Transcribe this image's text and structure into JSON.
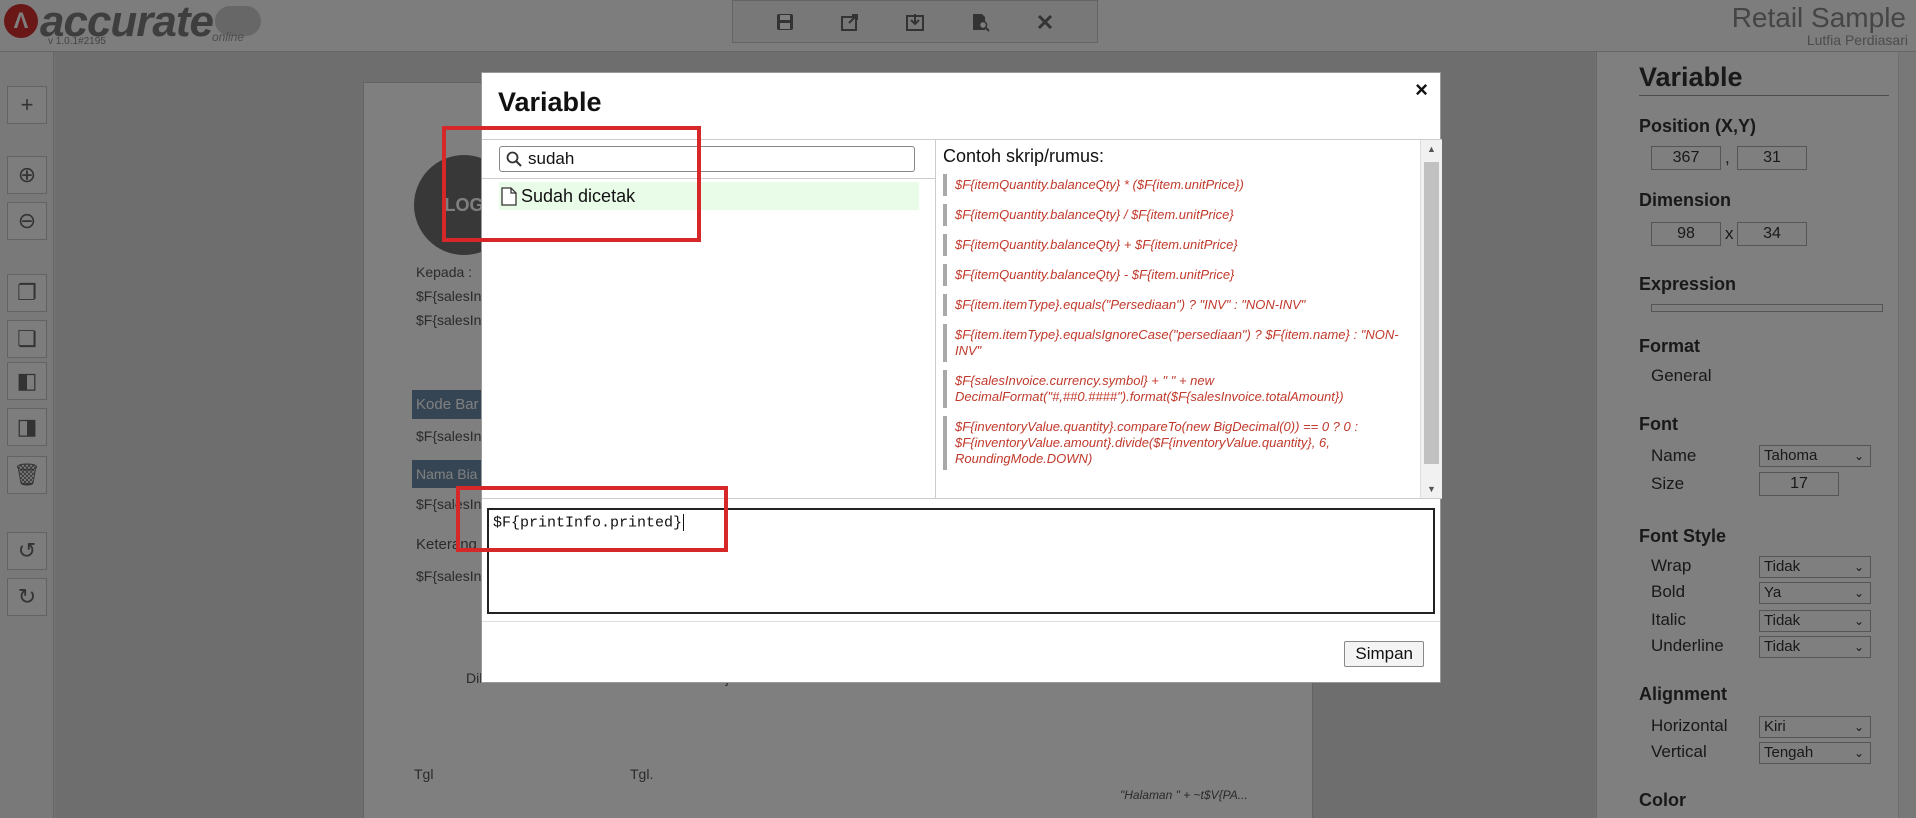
{
  "app": {
    "logo_mark": "Λ",
    "logo_text": "accurate",
    "logo_subtext": "online",
    "version": "v 1.0.1#2195",
    "title": "Retail Sample",
    "user": "Lutfia Perdiasari"
  },
  "toolbar": {
    "items": [
      "save-icon",
      "export-icon",
      "import-icon",
      "preview-icon",
      "close-icon"
    ]
  },
  "left_toolbar": {
    "items": [
      "add-icon",
      "zoom-in-icon",
      "zoom-out-icon",
      "copy-icon",
      "paste-icon",
      "bring-front-icon",
      "send-back-icon",
      "delete-icon",
      "undo-icon",
      "redo-icon"
    ]
  },
  "paper": {
    "logo": "LOG",
    "kepada": "Kepada :",
    "sales1": "$F{salesIn",
    "sales2": "$F{salesIn",
    "kode_bar": "Kode Bar",
    "sales3": "$F{salesIn",
    "nama_bia": "Nama Bia",
    "sales4": "$F{salesIn",
    "keterang": "Keterang",
    "sales5": "$F{salesIn",
    "dibuat": "Dibuat oleh",
    "disetujui": "Disetujui oleh",
    "tgl1": "Tgl",
    "tgl2": "Tgl.",
    "footer": "\"Halaman \" + ~t$V{PA..."
  },
  "panel": {
    "title": "Variable",
    "position_label": "Position (X,Y)",
    "pos_x": "367",
    "pos_sep": ",",
    "pos_y": "31",
    "dimension_label": "Dimension",
    "dim_w": "98",
    "dim_sep": "x",
    "dim_h": "34",
    "expression_label": "Expression",
    "format_label": "Format",
    "format_value": "General",
    "font_label": "Font",
    "font_name_label": "Name",
    "font_name_value": "Tahoma",
    "font_size_label": "Size",
    "font_size_value": "17",
    "font_style_label": "Font Style",
    "wrap_label": "Wrap",
    "wrap_value": "Tidak",
    "bold_label": "Bold",
    "bold_value": "Ya",
    "italic_label": "Italic",
    "italic_value": "Tidak",
    "underline_label": "Underline",
    "underline_value": "Tidak",
    "alignment_label": "Alignment",
    "horizontal_label": "Horizontal",
    "horizontal_value": "Kiri",
    "vertical_label": "Vertical",
    "vertical_value": "Tengah",
    "color_label": "Color"
  },
  "modal": {
    "title": "Variable",
    "close": "×",
    "search_value": "sudah",
    "result_label": "Sudah dicetak",
    "examples_heading": "Contoh skrip/rumus:",
    "examples": [
      "$F{itemQuantity.balanceQty} * ($F{item.unitPrice})",
      "$F{itemQuantity.balanceQty} / $F{item.unitPrice}",
      "$F{itemQuantity.balanceQty} + $F{item.unitPrice}",
      "$F{itemQuantity.balanceQty} - $F{item.unitPrice}",
      "$F{item.itemType}.equals(\"Persediaan\") ? \"INV\" : \"NON-INV\"",
      "$F{item.itemType}.equalsIgnoreCase(\"persediaan\") ? $F{item.name} : \"NON-INV\"",
      "$F{salesInvoice.currency.symbol} + \" \" + new DecimalFormat(\"#,##0.####\").format($F{salesInvoice.totalAmount})",
      "$F{inventoryValue.quantity}.compareTo(new BigDecimal(0)) == 0 ? 0 : $F{inventoryValue.amount}.divide($F{inventoryValue.quantity}, 6, RoundingMode.DOWN)"
    ],
    "expression": "$F{printInfo.printed}",
    "save_label": "Simpan"
  },
  "colors": {
    "highlight": "#d62828",
    "result_bg": "#e8fce8",
    "example_text": "#c0392b"
  }
}
